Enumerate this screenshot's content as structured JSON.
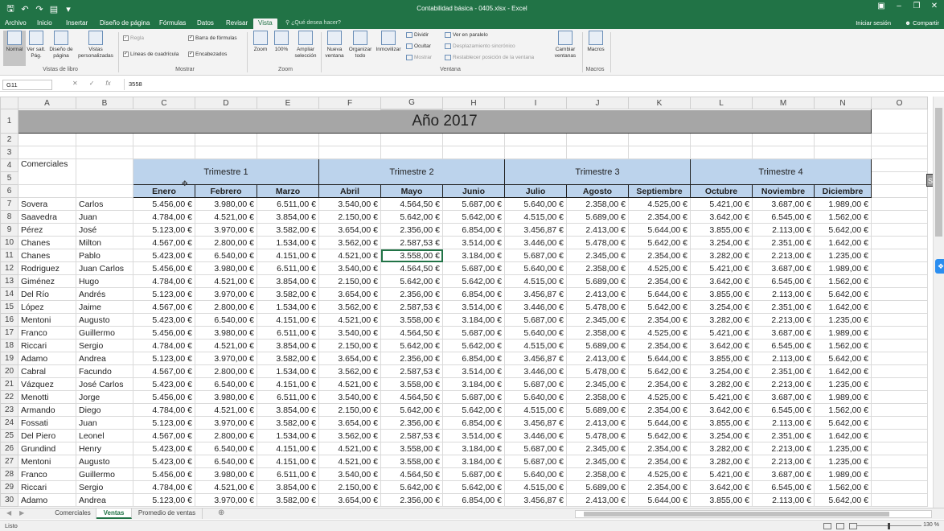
{
  "window": {
    "title": "Contabilidad básica - 0405.xlsx - Excel",
    "sign_in": "Iniciar sesión",
    "share": "Compartir"
  },
  "tabs": [
    "Archivo",
    "Inicio",
    "Insertar",
    "Diseño de página",
    "Fórmulas",
    "Datos",
    "Revisar",
    "Vista"
  ],
  "active_tab": "Vista",
  "tell_me": "¿Qué desea hacer?",
  "ribbon": {
    "groups": {
      "workbook_views": "Vistas de libro",
      "show": "Mostrar",
      "zoom": "Zoom",
      "window": "Ventana",
      "macros": "Macros"
    },
    "normal": "Normal",
    "page_break": "Ver salt. Pág.",
    "page_layout": "Diseño de página",
    "custom_views": "Vistas personalizadas",
    "ruler": "Regla",
    "formula_bar": "Barra de fórmulas",
    "gridlines": "Líneas de cuadrícula",
    "headings": "Encabezados",
    "zoom_btn": "Zoom",
    "zoom_100": "100%",
    "zoom_selection": "Ampliar selección",
    "new_window": "Nueva ventana",
    "arrange_all": "Organizar todo",
    "freeze": "Inmovilizar",
    "split": "Dividir",
    "hide": "Ocultar",
    "unhide": "Mostrar",
    "side_by_side": "Ver en paralelo",
    "sync_scroll": "Desplazamiento sincrónico",
    "reset_pos": "Restablecer posición de la ventana",
    "switch_windows": "Cambiar ventanas",
    "macros_btn": "Macros"
  },
  "formula_bar": {
    "name_box": "G11",
    "value": "3558"
  },
  "columns": [
    "A",
    "B",
    "C",
    "D",
    "E",
    "F",
    "G",
    "H",
    "I",
    "J",
    "K",
    "L",
    "M",
    "N",
    "O"
  ],
  "sheet": {
    "year_title": "Año 2017",
    "a4_label": "Comerciales",
    "quarters": [
      "Trimestre 1",
      "Trimestre 2",
      "Trimestre 3",
      "Trimestre 4"
    ],
    "months": [
      "Enero",
      "Febrero",
      "Marzo",
      "Abril",
      "Mayo",
      "Junio",
      "Julio",
      "Agosto",
      "Septiembre",
      "Octubre",
      "Noviembre",
      "Diciembre"
    ],
    "rows": [
      {
        "r": "7",
        "a": "Sovera",
        "b": "Carlos",
        "v": [
          "5.456,00 €",
          "3.980,00 €",
          "6.511,00 €",
          "3.540,00 €",
          "4.564,50 €",
          "5.687,00 €",
          "5.640,00 €",
          "2.358,00 €",
          "4.525,00 €",
          "5.421,00 €",
          "3.687,00 €",
          "1.989,00 €"
        ]
      },
      {
        "r": "8",
        "a": "Saavedra",
        "b": "Juan",
        "v": [
          "4.784,00 €",
          "4.521,00 €",
          "3.854,00 €",
          "2.150,00 €",
          "5.642,00 €",
          "5.642,00 €",
          "4.515,00 €",
          "5.689,00 €",
          "2.354,00 €",
          "3.642,00 €",
          "6.545,00 €",
          "1.562,00 €"
        ]
      },
      {
        "r": "9",
        "a": "Pérez",
        "b": "José",
        "v": [
          "5.123,00 €",
          "3.970,00 €",
          "3.582,00 €",
          "3.654,00 €",
          "2.356,00 €",
          "6.854,00 €",
          "3.456,87 €",
          "2.413,00 €",
          "5.644,00 €",
          "3.855,00 €",
          "2.113,00 €",
          "5.642,00 €"
        ]
      },
      {
        "r": "10",
        "a": "Chanes",
        "b": "Milton",
        "v": [
          "4.567,00 €",
          "2.800,00 €",
          "1.534,00 €",
          "3.562,00 €",
          "2.587,53 €",
          "3.514,00 €",
          "3.446,00 €",
          "5.478,00 €",
          "5.642,00 €",
          "3.254,00 €",
          "2.351,00 €",
          "1.642,00 €"
        ]
      },
      {
        "r": "11",
        "a": "Chanes",
        "b": "Pablo",
        "v": [
          "5.423,00 €",
          "6.540,00 €",
          "4.151,00 €",
          "4.521,00 €",
          "3.558,00 €",
          "3.184,00 €",
          "5.687,00 €",
          "2.345,00 €",
          "2.354,00 €",
          "3.282,00 €",
          "2.213,00 €",
          "1.235,00 €"
        ]
      },
      {
        "r": "12",
        "a": "Rodriguez",
        "b": "Juan Carlos",
        "v": [
          "5.456,00 €",
          "3.980,00 €",
          "6.511,00 €",
          "3.540,00 €",
          "4.564,50 €",
          "5.687,00 €",
          "5.640,00 €",
          "2.358,00 €",
          "4.525,00 €",
          "5.421,00 €",
          "3.687,00 €",
          "1.989,00 €"
        ]
      },
      {
        "r": "13",
        "a": "Giménez",
        "b": "Hugo",
        "v": [
          "4.784,00 €",
          "4.521,00 €",
          "3.854,00 €",
          "2.150,00 €",
          "5.642,00 €",
          "5.642,00 €",
          "4.515,00 €",
          "5.689,00 €",
          "2.354,00 €",
          "3.642,00 €",
          "6.545,00 €",
          "1.562,00 €"
        ]
      },
      {
        "r": "14",
        "a": "Del Río",
        "b": "Andrés",
        "v": [
          "5.123,00 €",
          "3.970,00 €",
          "3.582,00 €",
          "3.654,00 €",
          "2.356,00 €",
          "6.854,00 €",
          "3.456,87 €",
          "2.413,00 €",
          "5.644,00 €",
          "3.855,00 €",
          "2.113,00 €",
          "5.642,00 €"
        ]
      },
      {
        "r": "15",
        "a": "López",
        "b": "Jaime",
        "v": [
          "4.567,00 €",
          "2.800,00 €",
          "1.534,00 €",
          "3.562,00 €",
          "2.587,53 €",
          "3.514,00 €",
          "3.446,00 €",
          "5.478,00 €",
          "5.642,00 €",
          "3.254,00 €",
          "2.351,00 €",
          "1.642,00 €"
        ]
      },
      {
        "r": "16",
        "a": "Mentoni",
        "b": "Augusto",
        "v": [
          "5.423,00 €",
          "6.540,00 €",
          "4.151,00 €",
          "4.521,00 €",
          "3.558,00 €",
          "3.184,00 €",
          "5.687,00 €",
          "2.345,00 €",
          "2.354,00 €",
          "3.282,00 €",
          "2.213,00 €",
          "1.235,00 €"
        ]
      },
      {
        "r": "17",
        "a": "Franco",
        "b": "Guillermo",
        "v": [
          "5.456,00 €",
          "3.980,00 €",
          "6.511,00 €",
          "3.540,00 €",
          "4.564,50 €",
          "5.687,00 €",
          "5.640,00 €",
          "2.358,00 €",
          "4.525,00 €",
          "5.421,00 €",
          "3.687,00 €",
          "1.989,00 €"
        ]
      },
      {
        "r": "18",
        "a": "Riccari",
        "b": "Sergio",
        "v": [
          "4.784,00 €",
          "4.521,00 €",
          "3.854,00 €",
          "2.150,00 €",
          "5.642,00 €",
          "5.642,00 €",
          "4.515,00 €",
          "5.689,00 €",
          "2.354,00 €",
          "3.642,00 €",
          "6.545,00 €",
          "1.562,00 €"
        ]
      },
      {
        "r": "19",
        "a": "Adamo",
        "b": "Andrea",
        "v": [
          "5.123,00 €",
          "3.970,00 €",
          "3.582,00 €",
          "3.654,00 €",
          "2.356,00 €",
          "6.854,00 €",
          "3.456,87 €",
          "2.413,00 €",
          "5.644,00 €",
          "3.855,00 €",
          "2.113,00 €",
          "5.642,00 €"
        ]
      },
      {
        "r": "20",
        "a": "Cabral",
        "b": "Facundo",
        "v": [
          "4.567,00 €",
          "2.800,00 €",
          "1.534,00 €",
          "3.562,00 €",
          "2.587,53 €",
          "3.514,00 €",
          "3.446,00 €",
          "5.478,00 €",
          "5.642,00 €",
          "3.254,00 €",
          "2.351,00 €",
          "1.642,00 €"
        ]
      },
      {
        "r": "21",
        "a": "Vázquez",
        "b": "José Carlos",
        "v": [
          "5.423,00 €",
          "6.540,00 €",
          "4.151,00 €",
          "4.521,00 €",
          "3.558,00 €",
          "3.184,00 €",
          "5.687,00 €",
          "2.345,00 €",
          "2.354,00 €",
          "3.282,00 €",
          "2.213,00 €",
          "1.235,00 €"
        ]
      },
      {
        "r": "22",
        "a": "Menotti",
        "b": "Jorge",
        "v": [
          "5.456,00 €",
          "3.980,00 €",
          "6.511,00 €",
          "3.540,00 €",
          "4.564,50 €",
          "5.687,00 €",
          "5.640,00 €",
          "2.358,00 €",
          "4.525,00 €",
          "5.421,00 €",
          "3.687,00 €",
          "1.989,00 €"
        ]
      },
      {
        "r": "23",
        "a": "Armando",
        "b": "Diego",
        "v": [
          "4.784,00 €",
          "4.521,00 €",
          "3.854,00 €",
          "2.150,00 €",
          "5.642,00 €",
          "5.642,00 €",
          "4.515,00 €",
          "5.689,00 €",
          "2.354,00 €",
          "3.642,00 €",
          "6.545,00 €",
          "1.562,00 €"
        ]
      },
      {
        "r": "24",
        "a": "Fossati",
        "b": "Juan",
        "v": [
          "5.123,00 €",
          "3.970,00 €",
          "3.582,00 €",
          "3.654,00 €",
          "2.356,00 €",
          "6.854,00 €",
          "3.456,87 €",
          "2.413,00 €",
          "5.644,00 €",
          "3.855,00 €",
          "2.113,00 €",
          "5.642,00 €"
        ]
      },
      {
        "r": "25",
        "a": "Del Piero",
        "b": "Leonel",
        "v": [
          "4.567,00 €",
          "2.800,00 €",
          "1.534,00 €",
          "3.562,00 €",
          "2.587,53 €",
          "3.514,00 €",
          "3.446,00 €",
          "5.478,00 €",
          "5.642,00 €",
          "3.254,00 €",
          "2.351,00 €",
          "1.642,00 €"
        ]
      },
      {
        "r": "26",
        "a": "Grundind",
        "b": "Henry",
        "v": [
          "5.423,00 €",
          "6.540,00 €",
          "4.151,00 €",
          "4.521,00 €",
          "3.558,00 €",
          "3.184,00 €",
          "5.687,00 €",
          "2.345,00 €",
          "2.354,00 €",
          "3.282,00 €",
          "2.213,00 €",
          "1.235,00 €"
        ]
      },
      {
        "r": "27",
        "a": "Mentoni",
        "b": "Augusto",
        "v": [
          "5.423,00 €",
          "6.540,00 €",
          "4.151,00 €",
          "4.521,00 €",
          "3.558,00 €",
          "3.184,00 €",
          "5.687,00 €",
          "2.345,00 €",
          "2.354,00 €",
          "3.282,00 €",
          "2.213,00 €",
          "1.235,00 €"
        ]
      },
      {
        "r": "28",
        "a": "Franco",
        "b": "Guillermo",
        "v": [
          "5.456,00 €",
          "3.980,00 €",
          "6.511,00 €",
          "3.540,00 €",
          "4.564,50 €",
          "5.687,00 €",
          "5.640,00 €",
          "2.358,00 €",
          "4.525,00 €",
          "5.421,00 €",
          "3.687,00 €",
          "1.989,00 €"
        ]
      },
      {
        "r": "29",
        "a": "Riccari",
        "b": "Sergio",
        "v": [
          "4.784,00 €",
          "4.521,00 €",
          "3.854,00 €",
          "2.150,00 €",
          "5.642,00 €",
          "5.642,00 €",
          "4.515,00 €",
          "5.689,00 €",
          "2.354,00 €",
          "3.642,00 €",
          "6.545,00 €",
          "1.562,00 €"
        ]
      },
      {
        "r": "30",
        "a": "Adamo",
        "b": "Andrea",
        "v": [
          "5.123,00 €",
          "3.970,00 €",
          "3.582,00 €",
          "3.654,00 €",
          "2.356,00 €",
          "6.854,00 €",
          "3.456,87 €",
          "2.413,00 €",
          "5.644,00 €",
          "3.855,00 €",
          "2.113,00 €",
          "5.642,00 €"
        ]
      }
    ]
  },
  "sheet_tabs": [
    "Comerciales",
    "Ventas",
    "Promedio de ventas"
  ],
  "active_sheet": "Ventas",
  "status": {
    "ready": "Listo",
    "zoom": "130 %"
  },
  "colors": {
    "accent": "#217346",
    "header_fill": "#bcd3ec",
    "title_fill": "#a6a6a6"
  }
}
